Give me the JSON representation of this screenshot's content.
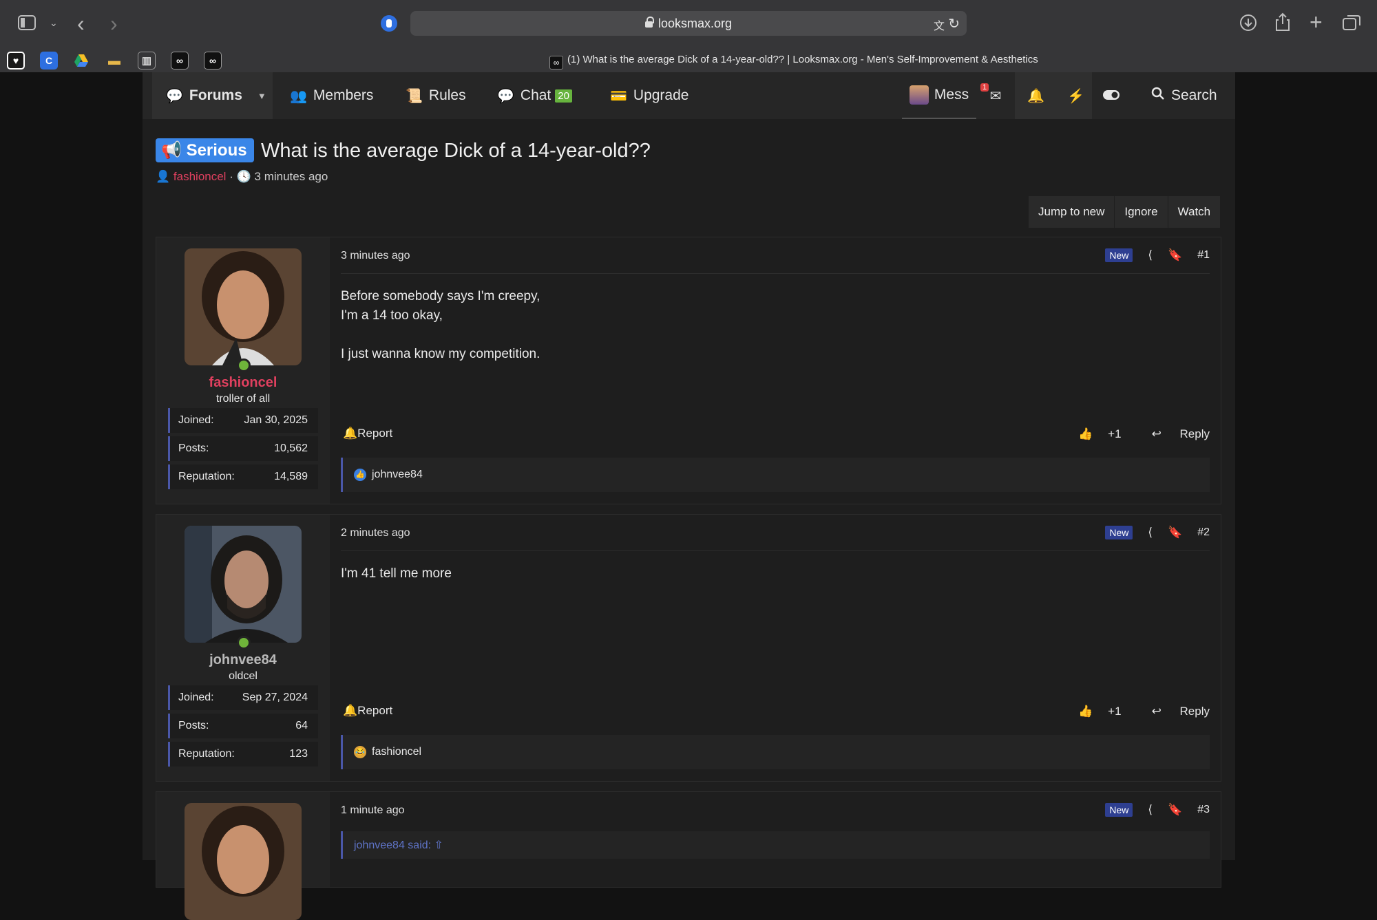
{
  "browser": {
    "url": "looksmax.org",
    "tab_title": "(1) What is the average Dick of a 14-year-old?? | Looksmax.org - Men's Self-Improvement & Aesthetics"
  },
  "nav": {
    "forums": "Forums",
    "members": "Members",
    "rules": "Rules",
    "chat": "Chat",
    "chat_count": "20",
    "upgrade": "Upgrade",
    "mess": "Mess",
    "mail_count": "1",
    "search": "Search"
  },
  "thread": {
    "prefix": "Serious",
    "title": "What is the average Dick of a 14-year-old??",
    "author": "fashioncel",
    "separator": "·",
    "time": "3 minutes ago",
    "actions": {
      "jump": "Jump to new",
      "ignore": "Ignore",
      "watch": "Watch"
    }
  },
  "labels": {
    "joined": "Joined:",
    "posts": "Posts:",
    "reputation": "Reputation:",
    "new": "New",
    "report": "Report",
    "plus_one": "+1",
    "reply": "Reply"
  },
  "posts": [
    {
      "number": "#1",
      "date": "3 minutes ago",
      "user": {
        "name": "fashioncel",
        "name_color": "#e0405f",
        "title": "troller of all",
        "joined": "Jan 30, 2025",
        "posts": "10,562",
        "reputation": "14,589"
      },
      "body": [
        "Before somebody says I'm creepy,",
        "I'm a 14 too okay,",
        "",
        "I just wanna know my competition."
      ],
      "reaction_user": "johnvee84",
      "reaction_type": "like"
    },
    {
      "number": "#2",
      "date": "2 minutes ago",
      "user": {
        "name": "johnvee84",
        "name_color": "#b9b9b9",
        "title": "oldcel",
        "joined": "Sep 27, 2024",
        "posts": "64",
        "reputation": "123"
      },
      "body": [
        "I'm 41 tell me more"
      ],
      "reaction_user": "fashioncel",
      "reaction_type": "haha"
    },
    {
      "number": "#3",
      "date": "1 minute ago",
      "quote": "johnvee84 said:"
    }
  ],
  "colors": {
    "accent": "#4a57a8",
    "prefix_blue": "#3a86e8",
    "new_badge": "#2e3f91",
    "online": "#6fb43a"
  }
}
